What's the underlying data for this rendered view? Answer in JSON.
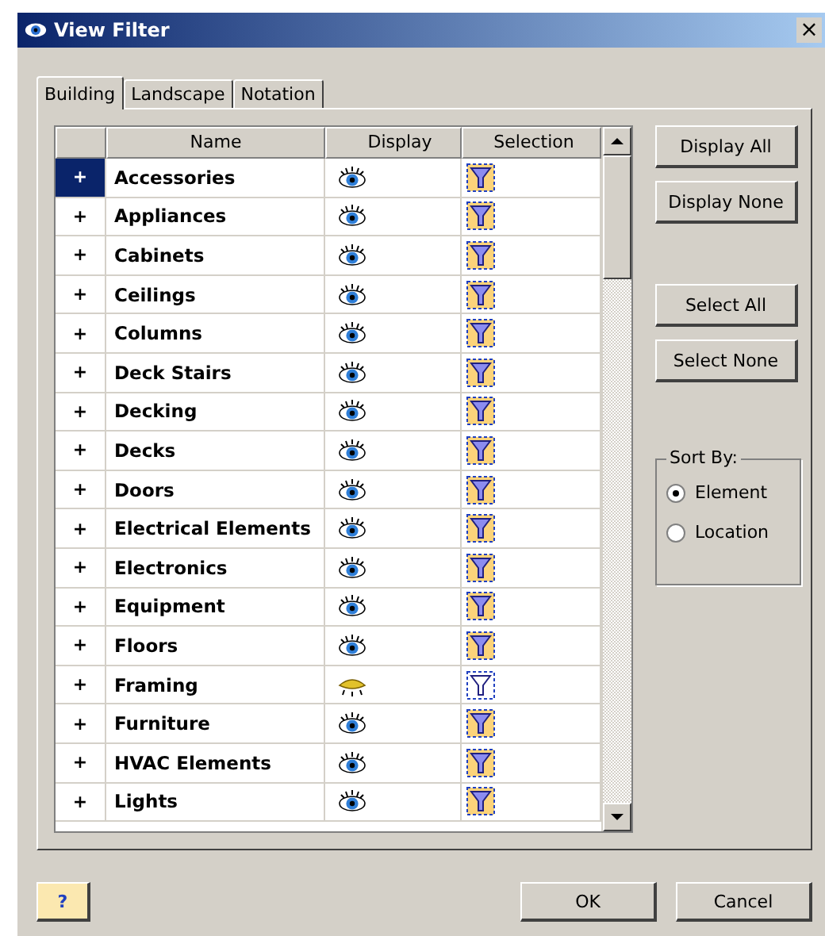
{
  "window": {
    "title": "View Filter",
    "close": "×"
  },
  "tabs": [
    {
      "label": "Building",
      "selected": true
    },
    {
      "label": "Landscape",
      "selected": false
    },
    {
      "label": "Notation",
      "selected": false
    }
  ],
  "table": {
    "columns": [
      "Name",
      "Display",
      "Selection"
    ],
    "rows": [
      {
        "toggle": "+",
        "name": "Accessories",
        "displayed": true,
        "filtered": true,
        "selected": true
      },
      {
        "toggle": "+",
        "name": "Appliances",
        "displayed": true,
        "filtered": true,
        "selected": false
      },
      {
        "toggle": "+",
        "name": "Cabinets",
        "displayed": true,
        "filtered": true,
        "selected": false
      },
      {
        "toggle": "+",
        "name": "Ceilings",
        "displayed": true,
        "filtered": true,
        "selected": false
      },
      {
        "toggle": "+",
        "name": "Columns",
        "displayed": true,
        "filtered": true,
        "selected": false
      },
      {
        "toggle": "+",
        "name": "Deck Stairs",
        "displayed": true,
        "filtered": true,
        "selected": false
      },
      {
        "toggle": "+",
        "name": "Decking",
        "displayed": true,
        "filtered": true,
        "selected": false
      },
      {
        "toggle": "+",
        "name": "Decks",
        "displayed": true,
        "filtered": true,
        "selected": false
      },
      {
        "toggle": "+",
        "name": "Doors",
        "displayed": true,
        "filtered": true,
        "selected": false
      },
      {
        "toggle": "+",
        "name": "Electrical Elements",
        "displayed": true,
        "filtered": true,
        "selected": false
      },
      {
        "toggle": "+",
        "name": "Electronics",
        "displayed": true,
        "filtered": true,
        "selected": false
      },
      {
        "toggle": "+",
        "name": "Equipment",
        "displayed": true,
        "filtered": true,
        "selected": false
      },
      {
        "toggle": "+",
        "name": "Floors",
        "displayed": true,
        "filtered": true,
        "selected": false
      },
      {
        "toggle": "+",
        "name": "Framing",
        "displayed": false,
        "filtered": false,
        "selected": false
      },
      {
        "toggle": "+",
        "name": "Furniture",
        "displayed": true,
        "filtered": true,
        "selected": false
      },
      {
        "toggle": "+",
        "name": "HVAC Elements",
        "displayed": true,
        "filtered": true,
        "selected": false
      },
      {
        "toggle": "+",
        "name": "Lights",
        "displayed": true,
        "filtered": true,
        "selected": false
      }
    ]
  },
  "display_buttons": [
    "Display All",
    "Display None"
  ],
  "select_buttons": [
    "Select All",
    "Select None"
  ],
  "sort_by": {
    "legend": "Sort By:",
    "options": [
      {
        "label": "Element",
        "selected": true
      },
      {
        "label": "Location",
        "selected": false
      }
    ]
  },
  "help_button": "?",
  "buttons": [
    "OK",
    "Cancel"
  ]
}
